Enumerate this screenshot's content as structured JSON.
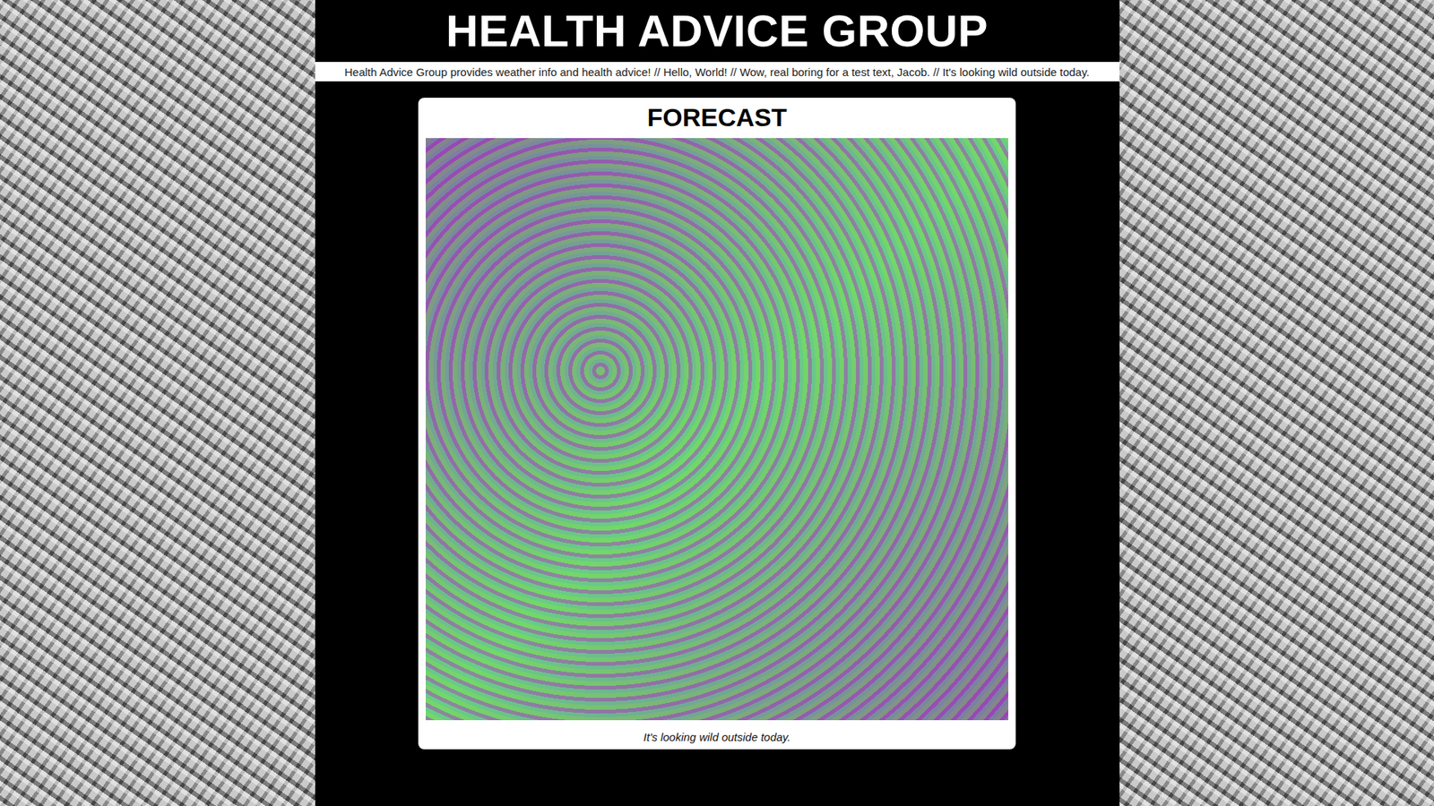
{
  "header": {
    "title": "HEALTH ADVICE GROUP"
  },
  "ticker": {
    "text": "Health Advice Group provides weather info and health advice! // Hello, World! // Wow, real boring for a test text, Jacob. // It's looking wild outside today."
  },
  "forecast": {
    "title": "FORECAST",
    "caption": "It's looking wild outside today."
  }
}
